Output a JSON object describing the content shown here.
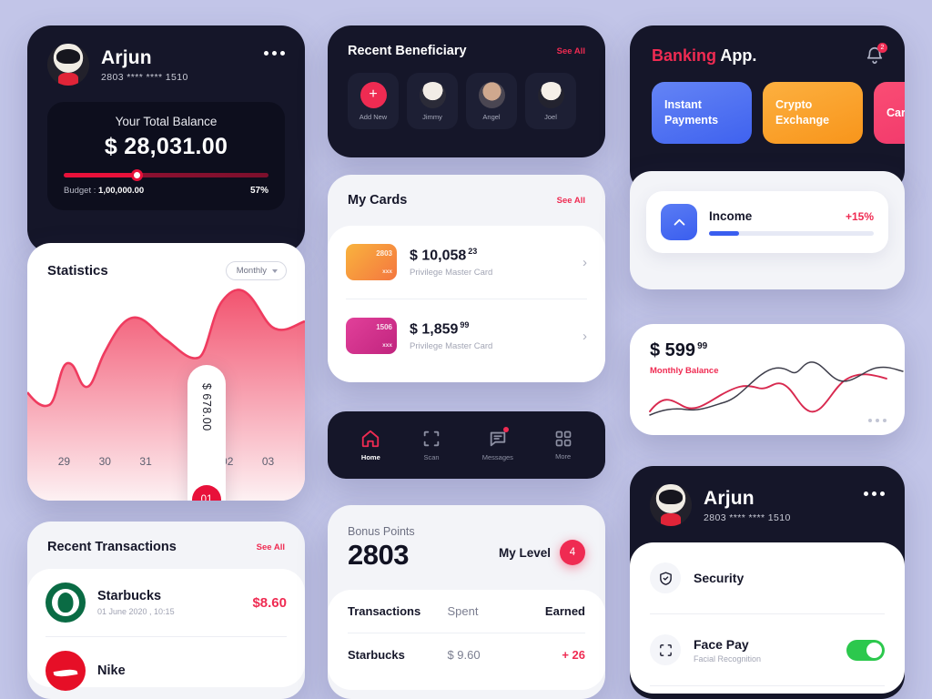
{
  "profile": {
    "name": "Arjun",
    "card_number": "2803 **** **** 1510",
    "menu_icon": "more-horizontal-icon",
    "balance_label": "Your Total Balance",
    "balance_amount": "$ 28,031.00",
    "budget_label": "Budget :",
    "budget_value": "1,00,000.00",
    "percent": "57%"
  },
  "statistics": {
    "title": "Statistics",
    "range_label": "Monthly",
    "tooltip_value": "$ 678.00",
    "selected_day": "01"
  },
  "chart_data": {
    "type": "area",
    "title": "Statistics",
    "categories": [
      "29",
      "30",
      "31",
      "01",
      "02",
      "03"
    ],
    "values": [
      52,
      68,
      88,
      64,
      70,
      96
    ],
    "xlabel": "",
    "ylabel": "",
    "highlight": {
      "category": "01",
      "value": "$ 678.00"
    },
    "series_color": "#ef3b5f",
    "fill_gradient": [
      "#f2536f",
      "#fdf0f3"
    ],
    "grid": false,
    "legend": false
  },
  "recent_transactions": {
    "title": "Recent Transactions",
    "see_all": "See All",
    "rows": [
      {
        "logo": "starbucks-logo",
        "name": "Starbucks",
        "date": "01 June 2020 , 10:15",
        "amount": "$8.60"
      },
      {
        "logo": "nike-logo",
        "name": "Nike",
        "date": "",
        "amount": ""
      }
    ]
  },
  "beneficiary": {
    "title": "Recent Beneficiary",
    "see_all": "See All",
    "items": [
      {
        "label": "Add New",
        "icon": "plus-icon"
      },
      {
        "label": "Jimmy",
        "icon": "avatar"
      },
      {
        "label": "Angel",
        "icon": "avatar"
      },
      {
        "label": "Joel",
        "icon": "avatar"
      }
    ]
  },
  "my_cards": {
    "title": "My Cards",
    "see_all": "See All",
    "rows": [
      {
        "number": "2803",
        "masked": "xxx",
        "amount": "$ 10,058",
        "cents": "23",
        "subtitle": "Privilege Master Card",
        "color": "#f4763f"
      },
      {
        "number": "1506",
        "masked": "xxx",
        "amount": "$ 1,859",
        "cents": "99",
        "subtitle": "Privilege Master Card",
        "color": "#c0247e"
      }
    ]
  },
  "bottom_nav": {
    "items": [
      {
        "label": "Home",
        "icon": "home-icon",
        "active": true,
        "badge": false
      },
      {
        "label": "Scan",
        "icon": "scan-icon",
        "active": false,
        "badge": false
      },
      {
        "label": "Messages",
        "icon": "message-icon",
        "active": false,
        "badge": true
      },
      {
        "label": "More",
        "icon": "grid-icon",
        "active": false,
        "badge": false
      }
    ]
  },
  "bonus_points": {
    "label": "Bonus Points",
    "value": "2803",
    "level_label": "My Level",
    "level_value": "4",
    "table": {
      "headers": [
        "Transactions",
        "Spent",
        "Earned"
      ],
      "rows": [
        [
          "Starbucks",
          "$ 9.60",
          "+ 26"
        ]
      ]
    }
  },
  "banking_app": {
    "title_accent": "Banking",
    "title_rest": " App.",
    "bell_icon": "bell-icon",
    "bell_badge": "2",
    "tiles": [
      {
        "label": "Instant Payments",
        "color": "#3f62ef"
      },
      {
        "label": "Crypto Exchange",
        "color": "#f8951b"
      },
      {
        "label": "Card Reissue",
        "color": "#f0356a"
      }
    ]
  },
  "income": {
    "icon": "arrow-up-icon",
    "label": "Income",
    "percent": "+15%",
    "progress": 18
  },
  "monthly_balance": {
    "amount": "$ 599",
    "cents": "99",
    "label": "Monthly Balance",
    "chart_line_colors": [
      "#d8294f",
      "#3d3d4a"
    ]
  },
  "security": {
    "name": "Arjun",
    "card_number": "2803 **** **** 1510",
    "menu_icon": "more-horizontal-icon",
    "rows": [
      {
        "icon": "shield-check-icon",
        "title": "Security",
        "subtitle": "",
        "toggle": false
      },
      {
        "icon": "face-scan-icon",
        "title": "Face Pay",
        "subtitle": "Facial Recognition",
        "toggle": true
      }
    ]
  },
  "colors": {
    "background": "#c2c5e8",
    "dark": "#151629",
    "accent": "#ef2b52",
    "green": "#2cc84d",
    "blue": "#3a5eef"
  }
}
